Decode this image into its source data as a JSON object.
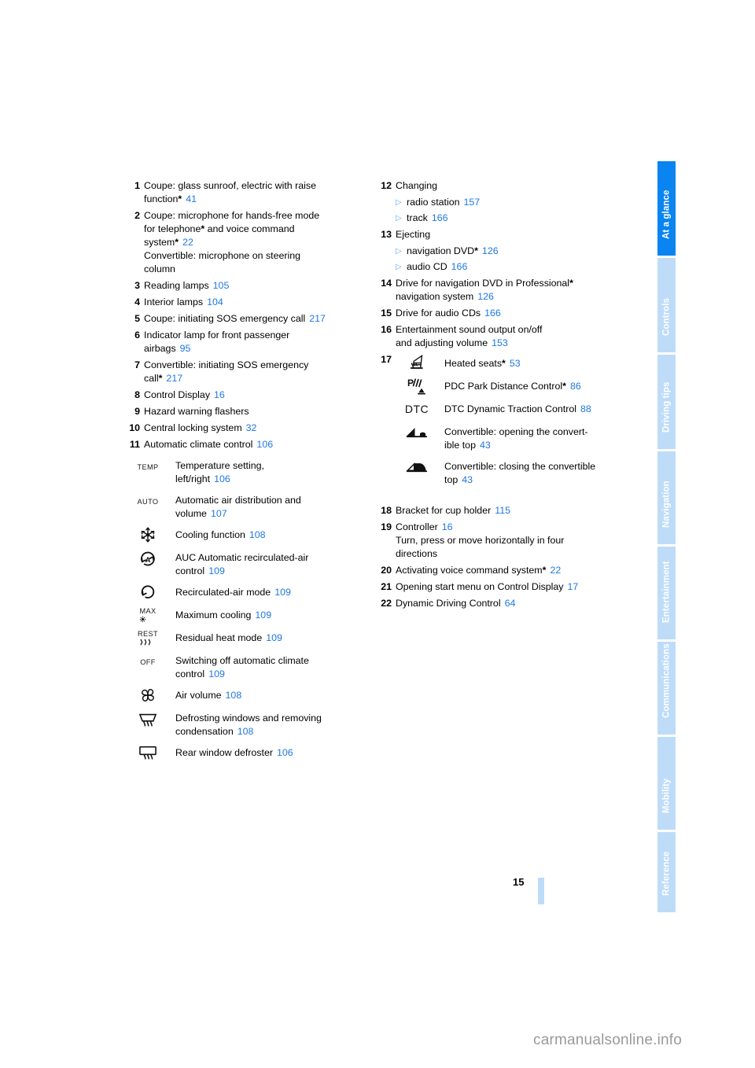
{
  "page": {
    "number": "15",
    "watermark": "carmanualsonline.info"
  },
  "sidebar": {
    "tabs": [
      {
        "label": "At a glance",
        "active": true
      },
      {
        "label": "Controls",
        "active": false
      },
      {
        "label": "Driving tips",
        "active": false
      },
      {
        "label": "Navigation",
        "active": false
      },
      {
        "label": "Entertainment",
        "active": false
      },
      {
        "label": "Communications",
        "active": false
      },
      {
        "label": "Mobility",
        "active": false
      },
      {
        "label": "Reference",
        "active": false
      }
    ]
  },
  "left_column": {
    "items": [
      {
        "num": "1",
        "lines": [
          "Coupe: glass sunroof, electric with raise",
          "function"
        ],
        "text_a": "Coupe: glass sunroof, electric with raise",
        "text_b": "function",
        "star": "*",
        "page": "41"
      },
      {
        "num": "2",
        "text_a": "Coupe: microphone for hands-free mode",
        "text_b": "for telephone",
        "star_b": "*",
        "text_c": " and voice command",
        "text_d": "system",
        "star_d": "*",
        "page": "22",
        "text_e": "Convertible: microphone on steering",
        "text_f": "column"
      },
      {
        "num": "3",
        "text": "Reading lamps",
        "page": "105"
      },
      {
        "num": "4",
        "text": "Interior lamps",
        "page": "104"
      },
      {
        "num": "5",
        "text": "Coupe: initiating SOS emergency call",
        "page": "217"
      },
      {
        "num": "6",
        "text_a": "Indicator lamp for front passenger",
        "text_b": "airbags",
        "page": "95"
      },
      {
        "num": "7",
        "text_a": "Convertible: initiating SOS emergency",
        "text_b": "call",
        "star": "*",
        "page": "217"
      },
      {
        "num": "8",
        "text": "Control Display",
        "page": "16"
      },
      {
        "num": "9",
        "text": "Hazard warning flashers",
        "page": ""
      },
      {
        "num": "10",
        "text": "Central locking system",
        "page": "32"
      },
      {
        "num": "11",
        "text": "Automatic climate control",
        "page": "106"
      }
    ],
    "climate_icons": [
      {
        "icon": "temp-icon",
        "glyph": "TEMP",
        "text_a": "Temperature setting,",
        "text_b": "left/right",
        "page": "106"
      },
      {
        "icon": "auto-icon",
        "glyph": "AUTO",
        "text_a": "Automatic air distribution and",
        "text_b": "volume",
        "page": "107"
      },
      {
        "icon": "snowflake-icon",
        "glyph": "",
        "text_a": "Cooling function",
        "text_b": "",
        "page": "108"
      },
      {
        "icon": "auc-recirculation-icon",
        "glyph": "",
        "text_a": "AUC Automatic recirculated-air",
        "text_b": "control",
        "page": "109"
      },
      {
        "icon": "recirculated-air-icon",
        "glyph": "",
        "text_a": "Recirculated-air mode",
        "text_b": "",
        "page": "109"
      },
      {
        "icon": "max-cooling-icon",
        "glyph": "MAX",
        "text_a": "Maximum cooling",
        "text_b": "",
        "page": "109"
      },
      {
        "icon": "residual-heat-icon",
        "glyph": "REST",
        "text_a": "Residual heat mode",
        "text_b": "",
        "page": "109"
      },
      {
        "icon": "off-icon",
        "glyph": "OFF",
        "text_a": "Switching off automatic climate",
        "text_b": "control",
        "page": "109"
      },
      {
        "icon": "fan-icon",
        "glyph": "",
        "text_a": "Air volume",
        "text_b": "",
        "page": "108"
      },
      {
        "icon": "windshield-defrost-icon",
        "glyph": "",
        "text_a": "Defrosting windows and removing",
        "text_b": "condensation",
        "page": "108"
      },
      {
        "icon": "rear-defroster-icon",
        "glyph": "",
        "text_a": "Rear window defroster",
        "text_b": "",
        "page": "106"
      }
    ]
  },
  "right_column": {
    "items": [
      {
        "num": "12",
        "text": "Changing",
        "subitems": [
          {
            "label": "radio station",
            "page": "157"
          },
          {
            "label": "track",
            "page": "166"
          }
        ]
      },
      {
        "num": "13",
        "text": "Ejecting",
        "subitems": [
          {
            "label": "navigation DVD",
            "star": "*",
            "page": "126"
          },
          {
            "label": "audio CD",
            "page": "166"
          }
        ]
      },
      {
        "num": "14",
        "text_a": "Drive for navigation DVD in Professional",
        "star": "*",
        "text_b": "navigation system",
        "page": "126"
      },
      {
        "num": "15",
        "text": "Drive for audio CDs",
        "page": "166"
      },
      {
        "num": "16",
        "text_a": "Entertainment sound output on/off",
        "text_b": "and adjusting volume",
        "page": "153"
      }
    ],
    "item17": {
      "num": "17",
      "rows": [
        {
          "icon": "heated-seat-icon",
          "glyph": "",
          "text_a": "Heated seats",
          "star": "*",
          "text_b": "",
          "page": "53"
        },
        {
          "icon": "pdc-icon",
          "glyph": "",
          "text_a": "PDC Park Distance Control",
          "star": "*",
          "text_b": "",
          "page": "86"
        },
        {
          "icon": "dtc-icon",
          "glyph": "DTC",
          "text_a": "DTC Dynamic Traction Control",
          "text_b": "",
          "page": "88"
        },
        {
          "icon": "convertible-top-open-icon",
          "glyph": "",
          "text_a": "Convertible: opening the convert-",
          "text_b": "ible top",
          "page": "43"
        },
        {
          "icon": "convertible-top-close-icon",
          "glyph": "",
          "text_a": "Convertible: closing the convertible",
          "text_b": "top",
          "page": "43"
        }
      ]
    },
    "items_tail": [
      {
        "num": "18",
        "text": "Bracket for cup holder",
        "page": "115"
      },
      {
        "num": "19",
        "text": "Controller",
        "page": "16",
        "text_b": "Turn, press or move horizontally in four",
        "text_c": "directions"
      },
      {
        "num": "20",
        "text": "Activating voice command system",
        "star": "*",
        "page": "22"
      },
      {
        "num": "21",
        "text": "Opening start menu on Control Display",
        "page": "17"
      },
      {
        "num": "22",
        "text": "Dynamic Driving Control",
        "page": "64"
      }
    ]
  },
  "colors": {
    "link": "#1f78e0",
    "tab_active": "#0a84f0",
    "tab_inactive": "#bedcf8",
    "triangle": "#57a8f5"
  }
}
